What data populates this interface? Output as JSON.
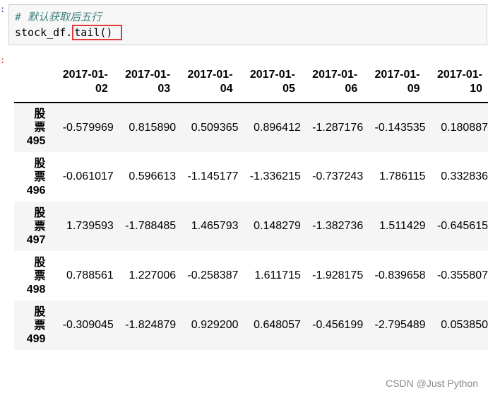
{
  "cell_in": {
    "prompt": ":",
    "comment": "# 默认获取后五行",
    "code_prefix": "stock_df.",
    "code_call": "tail()"
  },
  "cell_out": {
    "prompt": ":"
  },
  "table": {
    "columns": [
      "2017-01-\n02",
      "2017-01-\n03",
      "2017-01-\n04",
      "2017-01-\n05",
      "2017-01-\n06",
      "2017-01-\n09",
      "2017-01-\n10"
    ],
    "rows": [
      {
        "index": "股\n票\n495",
        "values": [
          "-0.579969",
          "0.815890",
          "0.509365",
          "0.896412",
          "-1.287176",
          "-0.143535",
          "0.180887"
        ]
      },
      {
        "index": "股\n票\n496",
        "values": [
          "-0.061017",
          "0.596613",
          "-1.145177",
          "-1.336215",
          "-0.737243",
          "1.786115",
          "0.332836"
        ]
      },
      {
        "index": "股\n票\n497",
        "values": [
          "1.739593",
          "-1.788485",
          "1.465793",
          "0.148279",
          "-1.382736",
          "1.511429",
          "-0.645615"
        ]
      },
      {
        "index": "股\n票\n498",
        "values": [
          "0.788561",
          "1.227006",
          "-0.258387",
          "1.611715",
          "-1.928175",
          "-0.839658",
          "-0.355807"
        ]
      },
      {
        "index": "股\n票\n499",
        "values": [
          "-0.309045",
          "-1.824879",
          "0.929200",
          "0.648057",
          "-0.456199",
          "-2.795489",
          "0.053850"
        ]
      }
    ]
  },
  "watermark": "CSDN @Just Python"
}
